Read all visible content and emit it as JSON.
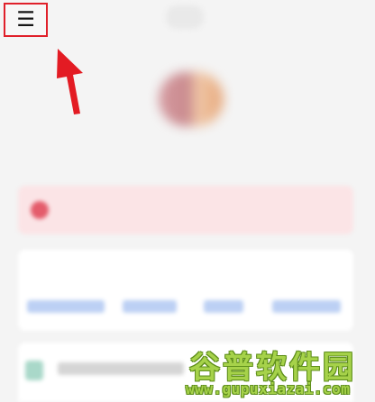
{
  "toolbar": {
    "menu_glyph": "☰",
    "menu_icon": "hamburger-menu-icon"
  },
  "profile": {
    "username": ""
  },
  "alert": {
    "text": ""
  },
  "info": {
    "label": ""
  },
  "watermark": {
    "cn": "谷普软件园",
    "url": "www.gupuxiazai.com",
    "logo": "gupu-logo"
  },
  "colors": {
    "highlight": "#e0202a",
    "alert_bg": "#fbe4e6",
    "link_blue": "#bcd0f4",
    "watermark_green": "#a6d24a"
  }
}
